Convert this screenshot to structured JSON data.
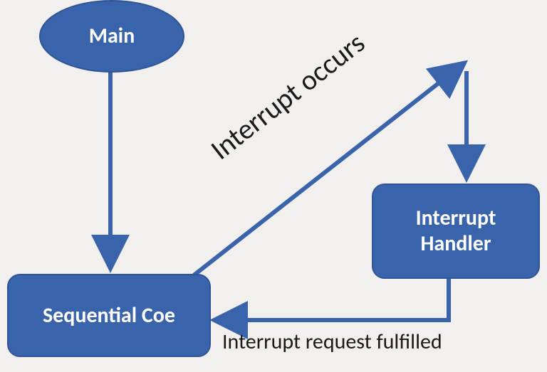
{
  "nodes": {
    "main": {
      "label": "Main"
    },
    "sequential": {
      "label": "Sequential Coe"
    },
    "handler": {
      "line1": "Interrupt",
      "line2": "Handler"
    }
  },
  "edges": {
    "interrupt_occurs": {
      "label": "Interrupt occurs"
    },
    "request_fulfilled": {
      "label": "Interrupt request fulfilled"
    }
  },
  "colors": {
    "node_fill": "#3964ab",
    "node_stroke": "#2f5596",
    "arrow": "#3964ab",
    "text_dark": "#1a1a1a",
    "text_light": "#ffffff",
    "background": "#f2f0ee"
  }
}
